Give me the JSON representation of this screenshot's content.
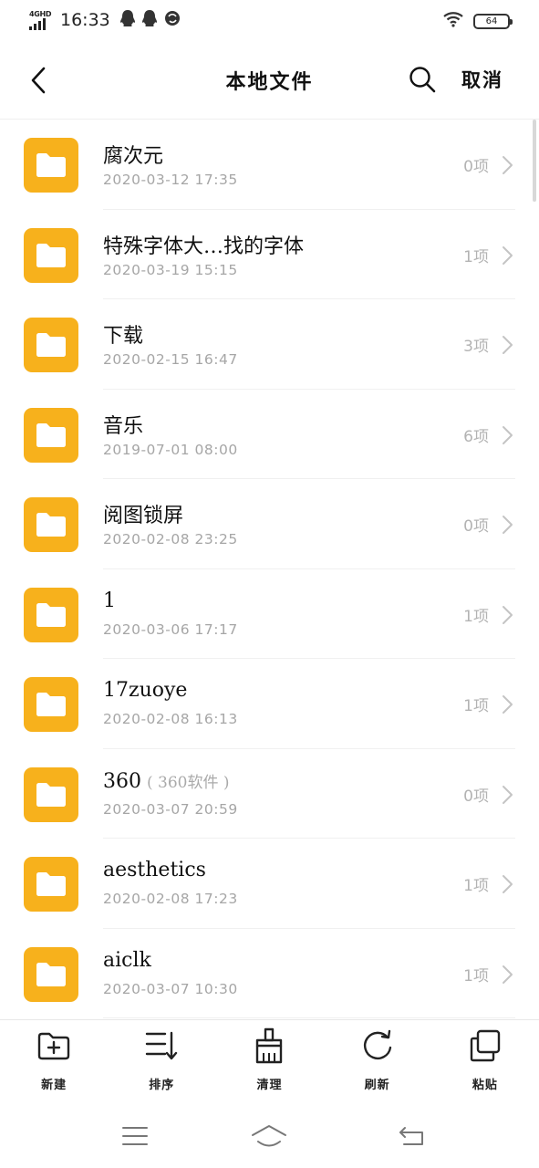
{
  "status_bar": {
    "network": "4GHD",
    "time": "16:33",
    "battery": "64"
  },
  "header": {
    "title": "本地文件",
    "cancel_label": "取消"
  },
  "files": [
    {
      "name": "腐次元",
      "note": "",
      "date": "2020-03-12 17:35",
      "count": "0项"
    },
    {
      "name": "特殊字体大…找的字体",
      "note": "",
      "date": "2020-03-19 15:15",
      "count": "1项"
    },
    {
      "name": "下载",
      "note": "",
      "date": "2020-02-15 16:47",
      "count": "3项"
    },
    {
      "name": "音乐",
      "note": "",
      "date": "2019-07-01 08:00",
      "count": "6项"
    },
    {
      "name": "阅图锁屏",
      "note": "",
      "date": "2020-02-08 23:25",
      "count": "0项"
    },
    {
      "name": "1",
      "note": "",
      "date": "2020-03-06 17:17",
      "count": "1项"
    },
    {
      "name": "17zuoye",
      "note": "",
      "date": "2020-02-08 16:13",
      "count": "1项"
    },
    {
      "name": "360",
      "note": "( 360软件 )",
      "date": "2020-03-07 20:59",
      "count": "0项"
    },
    {
      "name": "aesthetics",
      "note": "",
      "date": "2020-02-08 17:23",
      "count": "1项"
    },
    {
      "name": "aiclk",
      "note": "",
      "date": "2020-03-07 10:30",
      "count": "1项"
    }
  ],
  "toolbar": {
    "new_label": "新建",
    "sort_label": "排序",
    "clean_label": "清理",
    "refresh_label": "刷新",
    "paste_label": "粘贴"
  },
  "colors": {
    "folder": "#f7b11c",
    "secondary_text": "#a6a6a6"
  },
  "icons": [
    "back-arrow-icon",
    "search-icon",
    "folder-icon",
    "chevron-right-icon",
    "new-folder-icon",
    "sort-icon",
    "clean-brush-icon",
    "refresh-icon",
    "paste-icon",
    "menu-icon",
    "home-icon",
    "back-icon"
  ]
}
